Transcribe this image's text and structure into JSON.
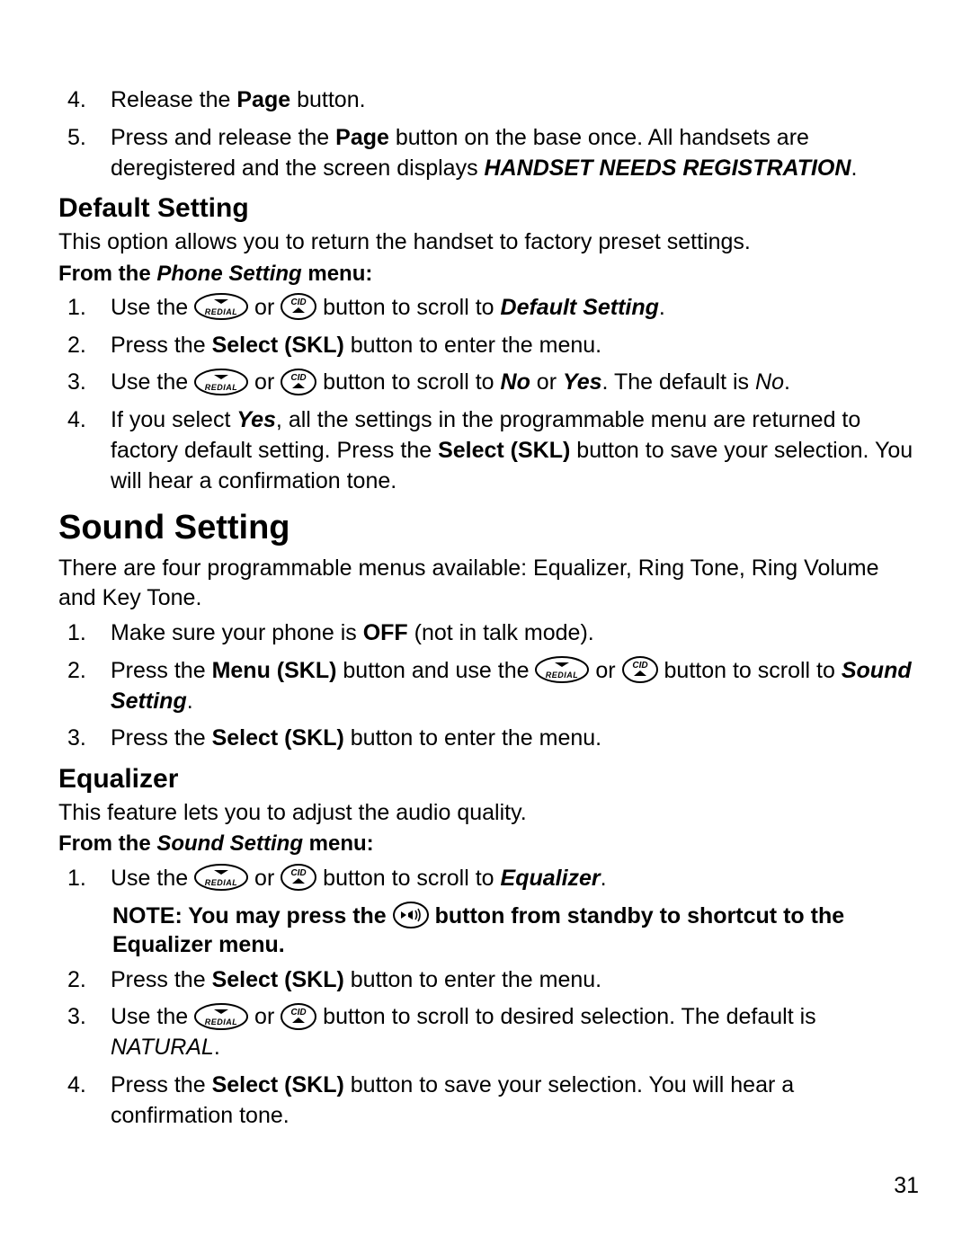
{
  "top_list": {
    "i4": {
      "num": "4.",
      "a": "Release the ",
      "b": "Page",
      "c": " button."
    },
    "i5": {
      "num": "5.",
      "a": "Press and release the ",
      "b": "Page",
      "c": " button on the base once. All handsets are deregistered and the screen displays ",
      "d": "HANDSET NEEDS REGISTRATION",
      "e": "."
    }
  },
  "default_setting": {
    "title": "Default Setting",
    "intro": "This option allows you to return the handset to factory preset settings.",
    "lead_a": "From the ",
    "lead_b": "Phone Setting",
    "lead_c": " menu:",
    "i1": {
      "num": "1.",
      "a": "Use the ",
      "b": " or ",
      "c": " button to scroll to ",
      "d": "Default Setting",
      "e": "."
    },
    "i2": {
      "num": "2.",
      "a": "Press the ",
      "b": "Select (SKL)",
      "c": " button to enter the menu."
    },
    "i3": {
      "num": "3.",
      "a": "Use the ",
      "b": " or ",
      "c": " button to scroll to ",
      "d": "No",
      "e": " or ",
      "f": "Yes",
      "g": ". The default is ",
      "h": "No",
      "i": "."
    },
    "i4": {
      "num": "4.",
      "a": "If you select ",
      "b": "Yes",
      "c": ", all the settings in the programmable menu are returned to factory default setting. Press the ",
      "d": "Select (SKL)",
      "e": " button to save your selection. You will hear a confirmation tone."
    }
  },
  "sound_setting": {
    "title": "Sound Setting",
    "intro": "There are four programmable menus available: Equalizer, Ring Tone, Ring Volume and Key Tone.",
    "i1": {
      "num": "1.",
      "a": "Make sure your phone is ",
      "b": "OFF",
      "c": " (not in talk mode)."
    },
    "i2": {
      "num": "2.",
      "a": "Press the ",
      "b": "Menu (SKL)",
      "c": " button and use the ",
      "d": " or ",
      "e": " button to scroll to ",
      "f": "Sound Setting",
      "g": "."
    },
    "i3": {
      "num": "3.",
      "a": "Press the ",
      "b": "Select (SKL)",
      "c": " button to enter the menu."
    }
  },
  "equalizer": {
    "title": "Equalizer",
    "intro": "This feature lets you to adjust the audio quality.",
    "lead_a": "From the ",
    "lead_b": "Sound Setting",
    "lead_c": " menu:",
    "i1": {
      "num": "1.",
      "a": "Use the ",
      "b": " or ",
      "c": " button to scroll to ",
      "d": "Equalizer",
      "e": "."
    },
    "note": {
      "a": "NOTE: You may press the ",
      "b": " button from standby to shortcut to the Equalizer menu."
    },
    "i2": {
      "num": "2.",
      "a": "Press the ",
      "b": "Select (SKL)",
      "c": " button to enter the menu."
    },
    "i3": {
      "num": "3.",
      "a": "Use the ",
      "b": " or ",
      "c": " button to scroll to desired selection. The default is ",
      "d": "NATURAL",
      "e": "."
    },
    "i4": {
      "num": "4.",
      "a": "Press the ",
      "b": "Select (SKL)",
      "c": " button to save your selection. You will hear a confirmation tone."
    }
  },
  "page_number": "31"
}
